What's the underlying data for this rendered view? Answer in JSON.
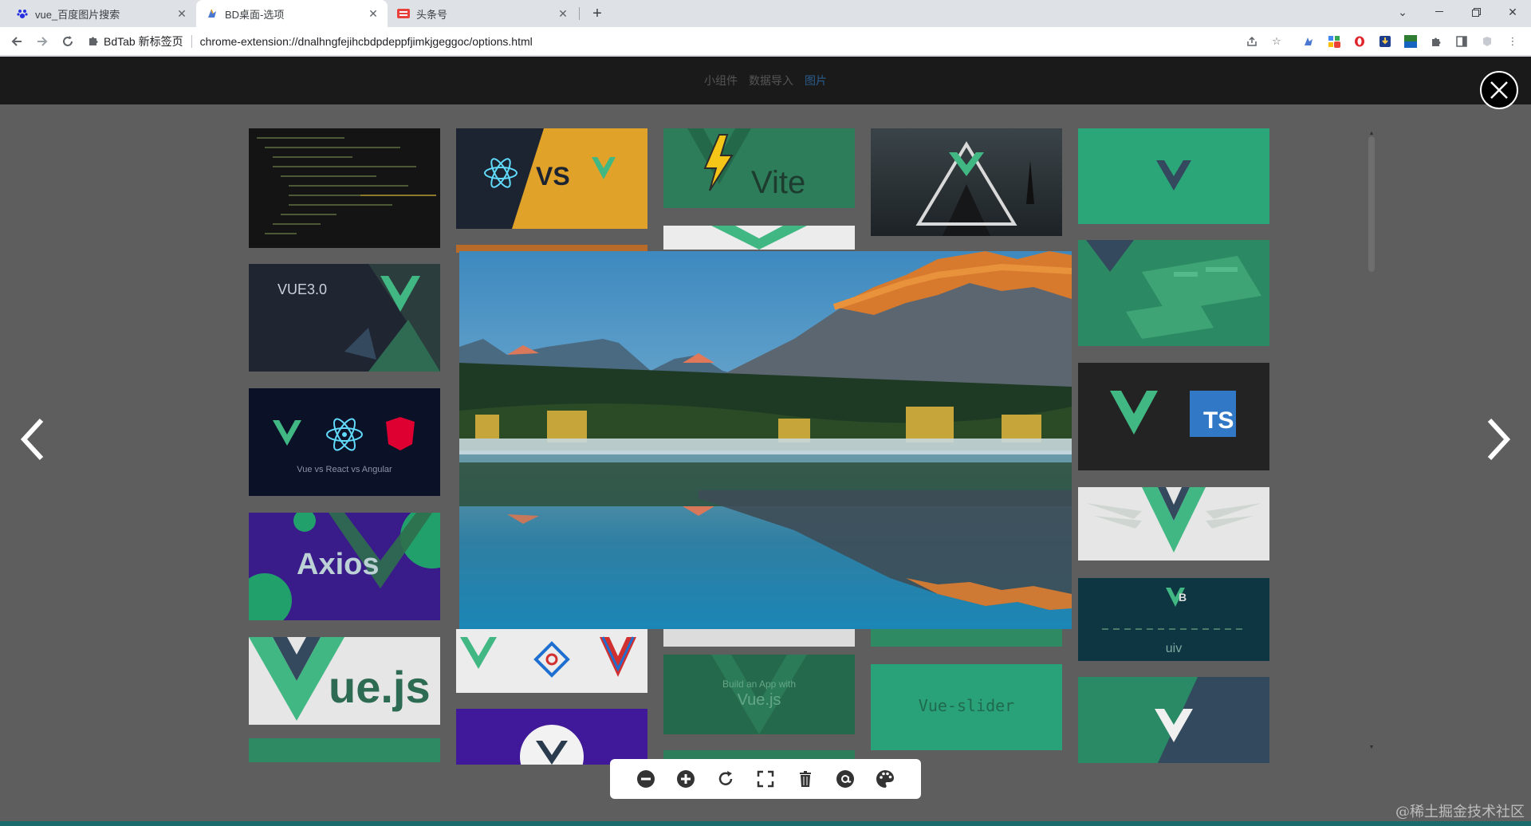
{
  "browser": {
    "tabs": [
      {
        "title": "vue_百度图片搜索",
        "favicon": "baidu-paw-icon"
      },
      {
        "title": "BD桌面-选项",
        "favicon": "bdtab-icon"
      },
      {
        "title": "头条号",
        "favicon": "toutiao-icon"
      }
    ],
    "new_tab": "+",
    "omnibox": {
      "extension_name": "BdTab 新标签页",
      "url": "chrome-extension://dnalhngfejihcbdpdeppfjimkjgeggoc/options.html"
    }
  },
  "page": {
    "nav": [
      {
        "label": "小组件"
      },
      {
        "label": "数据导入"
      },
      {
        "label": "图片",
        "active": true
      }
    ]
  },
  "gallery": {
    "tiles": [
      {
        "text": ""
      },
      {
        "text": "VS"
      },
      {
        "text": "Vite"
      },
      {
        "text": ""
      },
      {
        "text": ""
      },
      {
        "text": "VUE3.0"
      },
      {
        "text": ""
      },
      {
        "text": "TS"
      },
      {
        "text": "Vue vs React vs Angular"
      },
      {
        "text": ""
      },
      {
        "text": "Axios"
      },
      {
        "text": "uiv"
      },
      {
        "text": "ue.js"
      },
      {
        "text": "Build an App with"
      },
      {
        "text": "Vue.js"
      },
      {
        "text": "Vue-slider"
      },
      {
        "text": ""
      }
    ]
  },
  "viewer": {
    "toolbar": [
      {
        "name": "zoom-out-icon"
      },
      {
        "name": "zoom-in-icon"
      },
      {
        "name": "rotate-icon"
      },
      {
        "name": "fullscreen-icon"
      },
      {
        "name": "delete-icon"
      },
      {
        "name": "at-icon"
      },
      {
        "name": "palette-icon"
      }
    ]
  },
  "watermark": "@稀土掘金技术社区",
  "colors": {
    "vue_green": "#41b883",
    "vue_dark": "#35495e",
    "overlay": "#5e5e5e"
  }
}
